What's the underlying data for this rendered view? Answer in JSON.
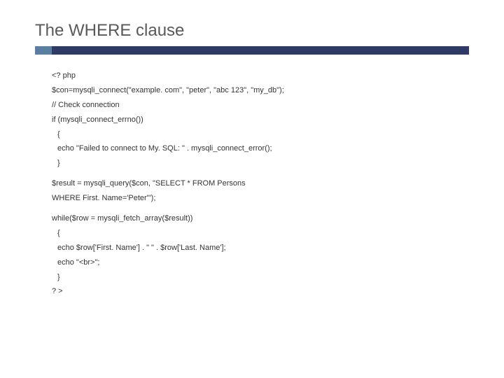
{
  "title": "The WHERE clause",
  "code": {
    "l1": "<? php",
    "l2": "$con=mysqli_connect(\"example. com\", \"peter\", \"abc 123\", \"my_db\");",
    "l3": "// Check connection",
    "l4": "if (mysqli_connect_errno())",
    "l5": "{",
    "l6": "echo \"Failed to connect to My. SQL: \" . mysqli_connect_error();",
    "l7": "}",
    "l8": "$result = mysqli_query($con, \"SELECT * FROM Persons",
    "l9": "WHERE First. Name='Peter'\");",
    "l10": "while($row = mysqli_fetch_array($result))",
    "l11": "{",
    "l12": "echo $row['First. Name'] . \" \" . $row['Last. Name'];",
    "l13": "echo \"<br>\";",
    "l14": "}",
    "l15": "? >"
  }
}
